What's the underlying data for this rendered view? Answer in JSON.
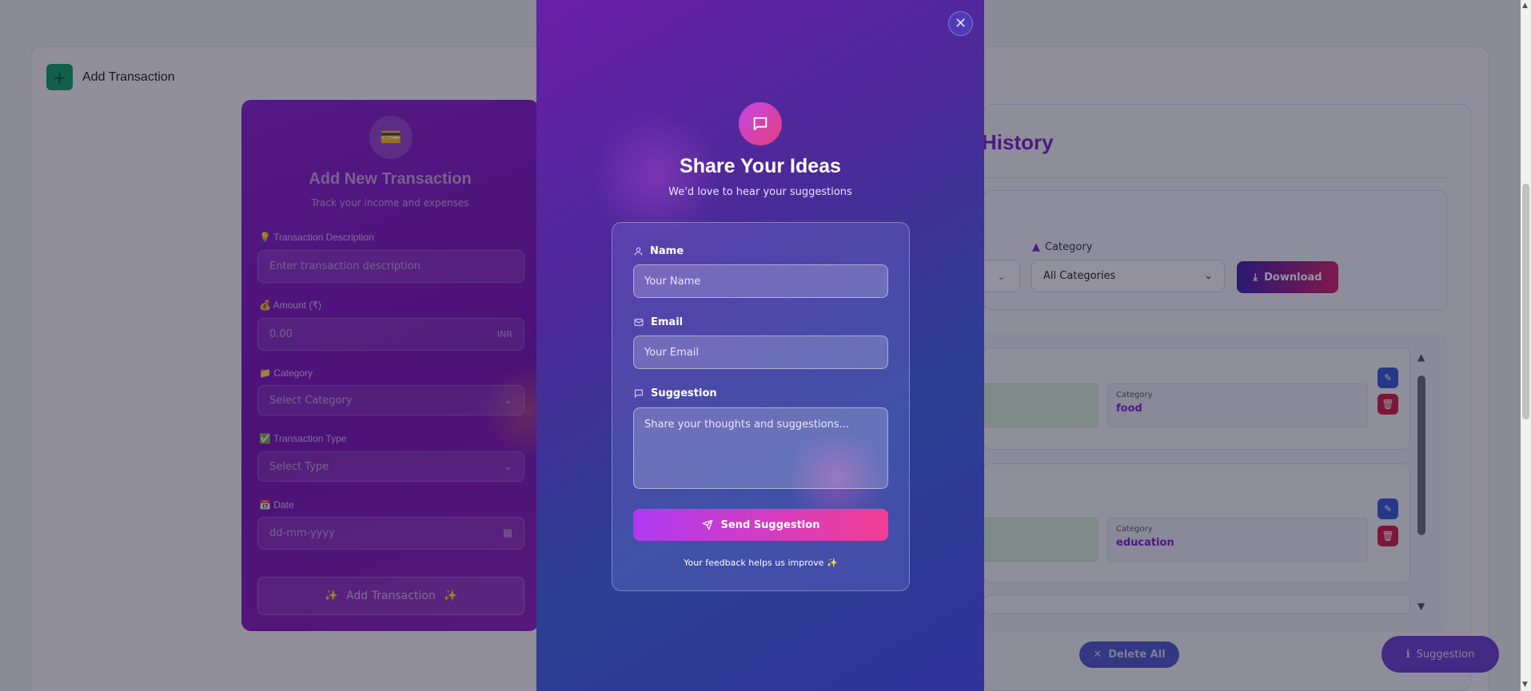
{
  "background": {
    "add_section_title": "Add Transaction",
    "form": {
      "icon": "credit-card-icon",
      "title": "Add New Transaction",
      "subtitle": "Track your income and expenses",
      "description_label": "Transaction Description",
      "description_placeholder": "Enter transaction description",
      "amount_label": "Amount (₹)",
      "amount_placeholder": "0.00",
      "amount_suffix": "INR",
      "category_label": "Category",
      "category_value": "Select Category",
      "type_label": "Transaction Type",
      "type_value": "Select Type",
      "date_label": "Date",
      "date_placeholder": "dd-mm-yyyy",
      "submit_label": "Add Transaction"
    },
    "history": {
      "title": "History",
      "category_filter_label": "Category",
      "category_filter_value": "All Categories",
      "download_label": "Download",
      "transactions": [
        {
          "category_key": "Category",
          "category_value": "food"
        },
        {
          "category_key": "Category",
          "category_value": "education"
        }
      ],
      "delete_all_label": "Delete All"
    },
    "suggestion_button_label": "Suggestion"
  },
  "modal": {
    "title": "Share Your Ideas",
    "subtitle": "We'd love to hear your suggestions",
    "name_label": "Name",
    "name_placeholder": "Your Name",
    "email_label": "Email",
    "email_placeholder": "Your Email",
    "suggestion_label": "Suggestion",
    "suggestion_placeholder": "Share your thoughts and suggestions...",
    "send_label": "Send Suggestion",
    "footer": "Your feedback helps us improve ✨"
  },
  "colors": {
    "brand_purple": "#7b22c6",
    "accent_pink": "#f23e94"
  }
}
